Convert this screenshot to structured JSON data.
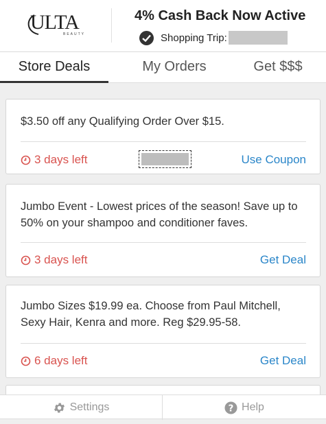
{
  "header": {
    "logo_text": "ULTA",
    "logo_sub": "BEAUTY",
    "cashback": "4% Cash Back Now Active",
    "trip_label": "Shopping Trip:"
  },
  "tabs": [
    {
      "label": "Store Deals",
      "active": true
    },
    {
      "label": "My Orders",
      "active": false
    },
    {
      "label": "Get $$$",
      "active": false
    }
  ],
  "deals": [
    {
      "text": "$3.50 off any Qualifying Order Over $15.",
      "expiry": "3 days left",
      "action": "Use Coupon",
      "has_code": true
    },
    {
      "text": "Jumbo Event - Lowest prices of the season! Save up to 50% on your shampoo and conditioner faves.",
      "expiry": "3 days left",
      "action": "Get Deal"
    },
    {
      "text": "Jumbo Sizes $19.99 ea. Choose from Paul Mitchell, Sexy Hair, Kenra and more. Reg $29.95-58.",
      "expiry": "6 days left",
      "action": "Get Deal"
    }
  ],
  "footer": {
    "settings": "Settings",
    "help": "Help"
  },
  "colors": {
    "expiry": "#d9534f",
    "action": "#2a86c9",
    "active_tab": "#333333"
  }
}
